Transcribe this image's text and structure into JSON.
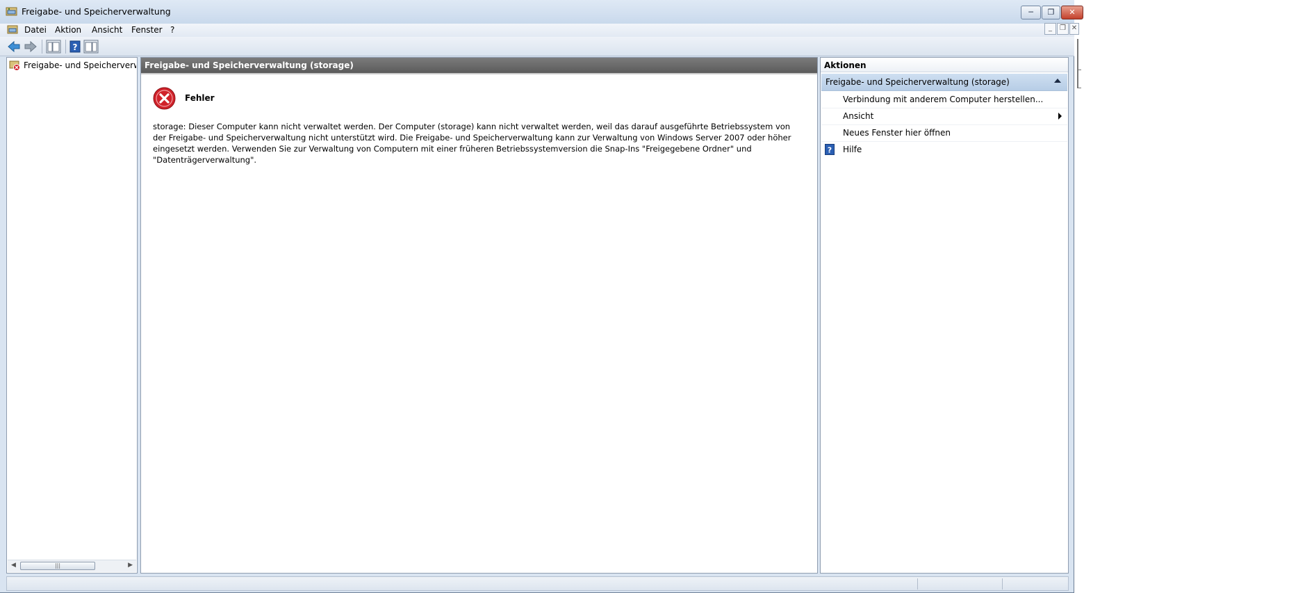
{
  "window": {
    "title": "Freigabe- und Speicherverwaltung",
    "app_icon": "share-storage-icon",
    "buttons": {
      "minimize": "minimize-icon",
      "maximize": "maximize-icon",
      "close": "close-icon"
    }
  },
  "menu": {
    "items": [
      "Datei",
      "Aktion",
      "Ansicht",
      "Fenster",
      "?"
    ]
  },
  "toolbar": {
    "buttons": [
      "back-arrow-icon",
      "forward-arrow-icon",
      "show-hide-console-tree-icon",
      "help-icon",
      "show-hide-action-pane-icon"
    ]
  },
  "tree": {
    "items": [
      {
        "label": "Freigabe- und Speicherverwaltung",
        "icon": "share-storage-error-icon"
      }
    ]
  },
  "main": {
    "header": "Freigabe- und Speicherverwaltung (storage)",
    "error_title": "Fehler",
    "error_text": "storage: Dieser Computer kann nicht verwaltet werden. Der Computer (storage) kann nicht verwaltet werden, weil das darauf ausgeführte Betriebssystem von der Freigabe- und Speicherverwaltung nicht unterstützt wird. Die Freigabe- und Speicherverwaltung kann zur Verwaltung von Windows Server 2007 oder höher eingesetzt werden. Verwenden Sie zur Verwaltung von Computern mit einer früheren Betriebssystemversion die Snap-Ins \"Freigegebene Ordner\" und \"Datenträgerverwaltung\"."
  },
  "actions": {
    "header": "Aktionen",
    "section_title": "Freigabe- und Speicherverwaltung (storage)",
    "items": [
      {
        "label": "Verbindung mit anderem Computer herstellen..."
      },
      {
        "label": "Ansicht"
      },
      {
        "label": "Neues Fenster hier öffnen"
      },
      {
        "label": "Hilfe",
        "icon": "help-icon"
      }
    ]
  },
  "colors": {
    "title_bar": "#d3e0ef",
    "main_header": "#6a6a6a",
    "action_section": "#c2d6ec",
    "error_red": "#d0222a"
  }
}
